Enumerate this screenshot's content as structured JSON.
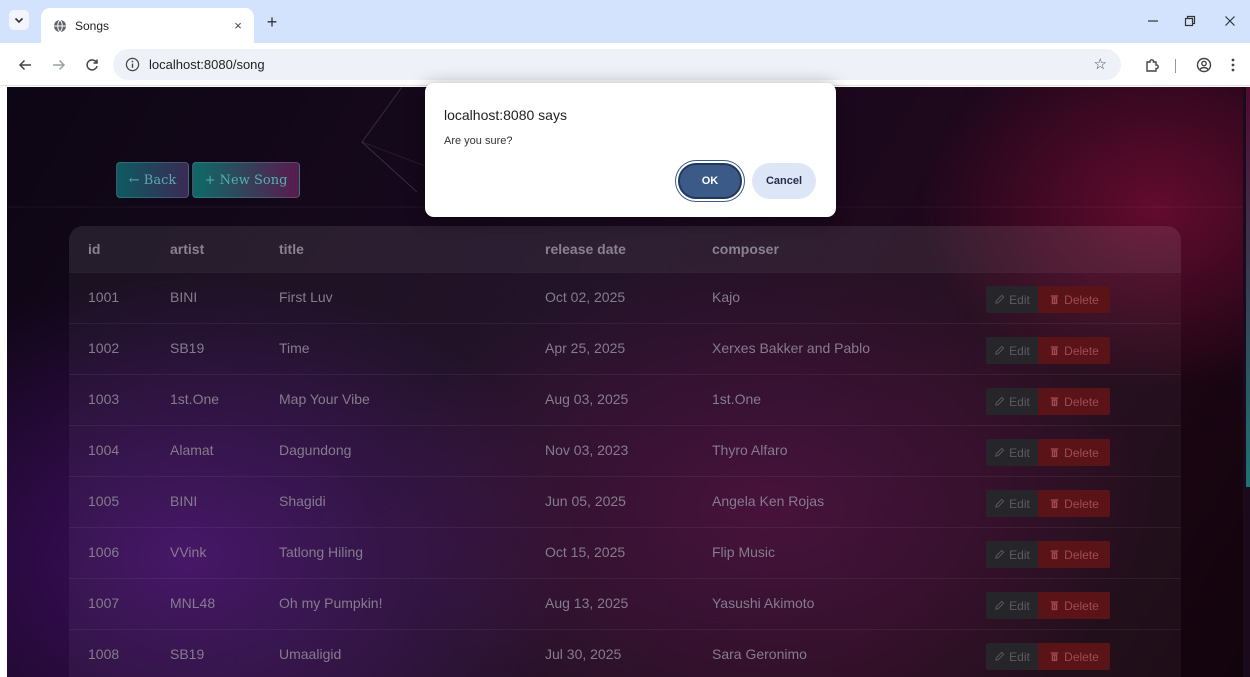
{
  "browser": {
    "tab_title": "Songs",
    "tab_close": "×",
    "new_tab": "+",
    "url": "localhost:8080/song"
  },
  "page": {
    "back_label": "← Back",
    "new_song_label": "+ New Song"
  },
  "table": {
    "headers": [
      "id",
      "artist",
      "title",
      "release date",
      "composer"
    ],
    "edit_label": "Edit",
    "delete_label": "Delete",
    "rows": [
      {
        "id": "1001",
        "artist": "BINI",
        "title": "First Luv",
        "release_date": "Oct 02, 2025",
        "composer": "Kajo"
      },
      {
        "id": "1002",
        "artist": "SB19",
        "title": "Time",
        "release_date": "Apr 25, 2025",
        "composer": "Xerxes Bakker and Pablo"
      },
      {
        "id": "1003",
        "artist": "1st.One",
        "title": "Map Your Vibe",
        "release_date": "Aug 03, 2025",
        "composer": "1st.One"
      },
      {
        "id": "1004",
        "artist": "Alamat",
        "title": "Dagundong",
        "release_date": "Nov 03, 2023",
        "composer": "Thyro Alfaro"
      },
      {
        "id": "1005",
        "artist": "BINI",
        "title": "Shagidi",
        "release_date": "Jun 05, 2025",
        "composer": "Angela Ken Rojas"
      },
      {
        "id": "1006",
        "artist": "VVink",
        "title": "Tatlong Hiling",
        "release_date": "Oct 15, 2025",
        "composer": "Flip Music"
      },
      {
        "id": "1007",
        "artist": "MNL48",
        "title": "Oh my Pumpkin!",
        "release_date": "Aug 13, 2025",
        "composer": "Yasushi Akimoto"
      },
      {
        "id": "1008",
        "artist": "SB19",
        "title": "Umaaligid",
        "release_date": "Jul 30, 2025",
        "composer": "Sara Geronimo"
      }
    ]
  },
  "dialog": {
    "title": "localhost:8080 says",
    "message": "Are you sure?",
    "ok_label": "OK",
    "cancel_label": "Cancel"
  }
}
